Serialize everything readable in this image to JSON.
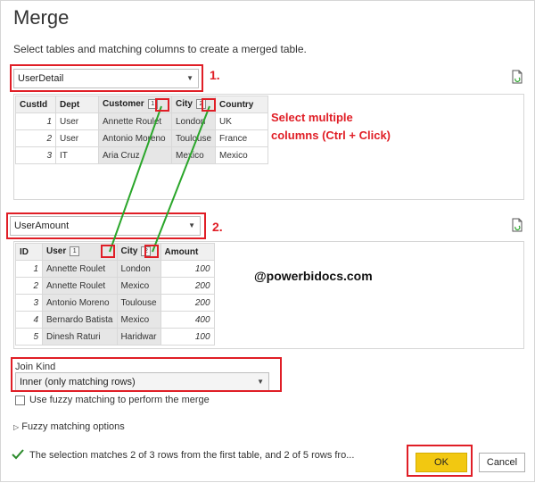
{
  "dialog": {
    "title": "Merge",
    "subtitle": "Select tables and matching columns to create a merged table."
  },
  "first_table": {
    "selected": "UserDetail",
    "columns": [
      "CustId",
      "Dept",
      "Customer",
      "City",
      "Country"
    ],
    "match_order": {
      "Customer": "1",
      "City": "2"
    },
    "rows": [
      [
        "1",
        "User",
        "Annette Roulet",
        "London",
        "UK"
      ],
      [
        "2",
        "User",
        "Antonio Moreno",
        "Toulouse",
        "France"
      ],
      [
        "3",
        "IT",
        "Aria Cruz",
        "Mexico",
        "Mexico"
      ]
    ]
  },
  "second_table": {
    "selected": "UserAmount",
    "columns": [
      "ID",
      "User",
      "City",
      "Amount"
    ],
    "match_order": {
      "User": "1",
      "City": "2"
    },
    "rows": [
      [
        "1",
        "Annette Roulet",
        "London",
        "100"
      ],
      [
        "2",
        "Annette Roulet",
        "Mexico",
        "200"
      ],
      [
        "3",
        "Antonio Moreno",
        "Toulouse",
        "200"
      ],
      [
        "4",
        "Bernardo Batista",
        "Mexico",
        "400"
      ],
      [
        "5",
        "Dinesh Raturi",
        "Haridwar",
        "100"
      ]
    ]
  },
  "annotations": {
    "step1": "1.",
    "step2": "2.",
    "note_line1": "Select multiple",
    "note_line2": "columns (Ctrl + Click)",
    "watermark": "@powerbidocs.com",
    "accent": "#e01e26",
    "line_color": "#2aa62a"
  },
  "join": {
    "label": "Join Kind",
    "selected": "Inner (only matching rows)",
    "fuzzy_label": "Use fuzzy matching to perform the merge",
    "fuzzy_options": "Fuzzy matching options"
  },
  "status": {
    "icon": "check-icon",
    "text": "The selection matches 2 of 3 rows from the first table, and 2 of 5 rows fro..."
  },
  "buttons": {
    "ok": "OK",
    "cancel": "Cancel",
    "ok_color": "#f2c811"
  }
}
